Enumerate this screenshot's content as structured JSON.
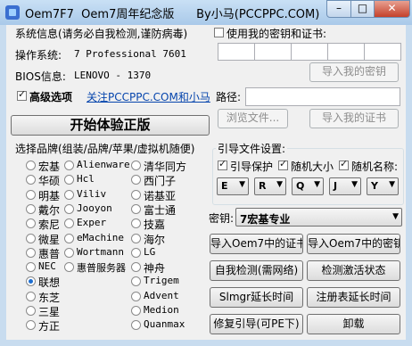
{
  "window": {
    "title": "Oem7F7  Oem7周年纪念版      By小马(PCCPPC.COM)",
    "minimize_glyph": "–",
    "maximize_glyph": "□",
    "close_glyph": "✕"
  },
  "sysinfo": {
    "heading": "系统信息(请务必自我检测,谨防病毒)",
    "os_label": "操作系统:",
    "os_value": "7 Professional 7601",
    "bios_label": "BIOS信息:",
    "bios_value": "LENOVO - 1370"
  },
  "advanced": {
    "label": "高级选项",
    "follow_link": "关注PCCPPC.COM和小马"
  },
  "start_button": "开始体验正版",
  "brand_section": {
    "label": "选择品牌(组装/品牌/苹果/虚拟机随便)"
  },
  "brands": {
    "col1": [
      "宏基",
      "华硕",
      "明基",
      "戴尔",
      "索尼",
      "微星",
      "惠普",
      "NEC",
      "联想",
      "东芝",
      "三星",
      "方正"
    ],
    "col2": [
      "Alienware",
      "Hcl",
      "Viliv",
      "Jooyon",
      "Exper",
      "eMachine",
      "Wortmann",
      "惠普服务器"
    ],
    "col3": [
      "清华同方",
      "西门子",
      "诺基亚",
      "富士通",
      "技嘉",
      "海尔",
      "LG",
      "神舟",
      "Trigem",
      "Advent",
      "Medion",
      "Quanmax"
    ],
    "selected": "联想"
  },
  "own_key": {
    "label": "使用我的密钥和证书:",
    "import_key": "导入我的密钥",
    "path_label": "路径:",
    "browse": "浏览文件...",
    "import_cert": "导入我的证书"
  },
  "boot_settings": {
    "label": "引导文件设置:",
    "protect": "引导保护",
    "random_size": "随机大小",
    "random_name": "随机名称:",
    "letters": [
      "E",
      "R",
      "Q",
      "J",
      "Y"
    ]
  },
  "key_select": {
    "label": "密钥:",
    "value": "7宏基专业"
  },
  "actions": {
    "import_cert": "导入Oem7中的证书",
    "import_key": "导入Oem7中的密钥",
    "self_check": "自我检测(需网络)",
    "check_activation": "检测激活状态",
    "slmgr": "Slmgr延长时间",
    "reg_extend": "注册表延长时间",
    "repair_boot": "修复引导(可PE下)",
    "uninstall": "卸载"
  }
}
